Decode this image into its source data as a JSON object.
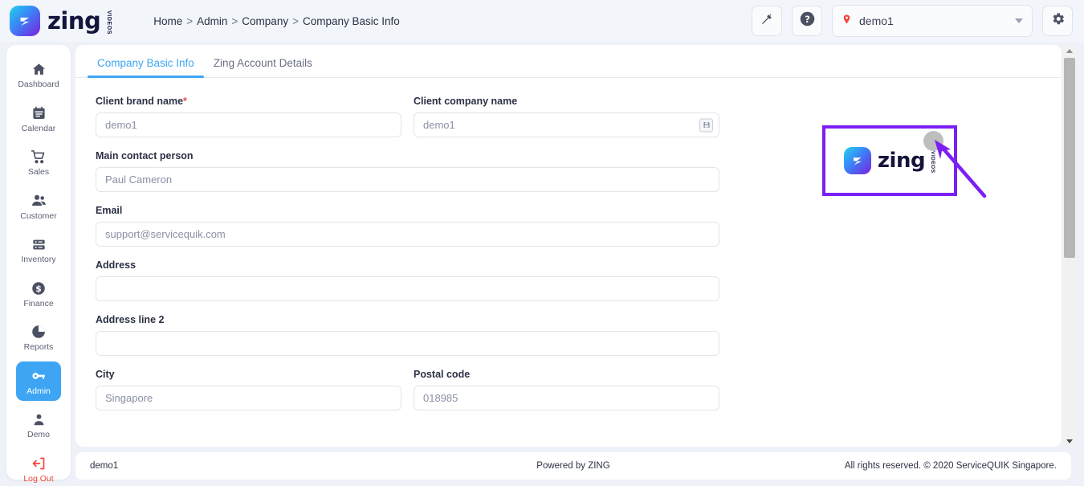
{
  "brand": {
    "logo_text": "zing",
    "logo_subtext": "VIDEOS",
    "mark_icon": "zing-bolt-icon"
  },
  "header": {
    "breadcrumb": [
      {
        "label": "Home",
        "sep": ">"
      },
      {
        "label": "Admin",
        "sep": ">"
      },
      {
        "label": "Company",
        "sep": ">"
      },
      {
        "label": "Company Basic Info",
        "sep": ""
      }
    ],
    "magic_button_icon": "magic-wand-icon",
    "help_button_icon": "help-circle-icon",
    "settings_button_icon": "gear-icon",
    "location_selector": {
      "icon": "map-pin-icon",
      "value": "demo1",
      "caret_icon": "chevron-down-icon"
    }
  },
  "sidebar": {
    "items": [
      {
        "label": "Dashboard",
        "icon": "home-icon",
        "active": false
      },
      {
        "label": "Calendar",
        "icon": "calendar-icon",
        "active": false
      },
      {
        "label": "Sales",
        "icon": "shopping-cart-icon",
        "active": false
      },
      {
        "label": "Customer",
        "icon": "users-icon",
        "active": false
      },
      {
        "label": "Inventory",
        "icon": "server-stack-icon",
        "active": false
      },
      {
        "label": "Finance",
        "icon": "dollar-circle-icon",
        "active": false
      },
      {
        "label": "Reports",
        "icon": "pie-chart-icon",
        "active": false
      },
      {
        "label": "Admin",
        "icon": "key-icon",
        "active": true
      },
      {
        "label": "Demo",
        "icon": "user-icon",
        "active": false
      }
    ],
    "logout": {
      "label": "Log Out",
      "icon": "logout-icon",
      "color": "#f4463c"
    }
  },
  "tabs": [
    {
      "label": "Company Basic Info",
      "active": true
    },
    {
      "label": "Zing Account Details",
      "active": false
    }
  ],
  "form": {
    "client_brand_name": {
      "label": "Client brand name",
      "required_marker": "*",
      "value": "demo1",
      "placeholder": "demo1"
    },
    "client_company_name": {
      "label": "Client company name",
      "value": "demo1",
      "placeholder": "demo1",
      "action_icon": "save-disk-icon"
    },
    "main_contact_person": {
      "label": "Main contact person",
      "value": "Paul Cameron",
      "placeholder": "Paul Cameron"
    },
    "email": {
      "label": "Email",
      "value": "support@servicequik.com",
      "placeholder": "support@servicequik.com"
    },
    "address": {
      "label": "Address",
      "value": "",
      "placeholder": ""
    },
    "address_line_2": {
      "label": "Address line 2",
      "value": "",
      "placeholder": ""
    },
    "city": {
      "label": "City",
      "value": "Singapore",
      "placeholder": "Singapore"
    },
    "postal_code": {
      "label": "Postal code",
      "value": "018985",
      "placeholder": "018985"
    }
  },
  "logo_preview": {
    "text": "zing",
    "subtext": "VIDEOS",
    "annotation_color": "#7b1ff5"
  },
  "footer": {
    "left": "demo1",
    "center": "Powered by ZING",
    "right": "All rights reserved. © 2020 ServiceQUIK Singapore."
  },
  "colors": {
    "accent": "#3da5f4",
    "danger": "#f4463c",
    "annotation": "#7b1ff5",
    "page_bg": "#eef1f7",
    "card_bg": "#ffffff"
  },
  "scrollbar": {
    "up_icon": "triangle-up-icon",
    "down_icon": "triangle-down-icon"
  }
}
